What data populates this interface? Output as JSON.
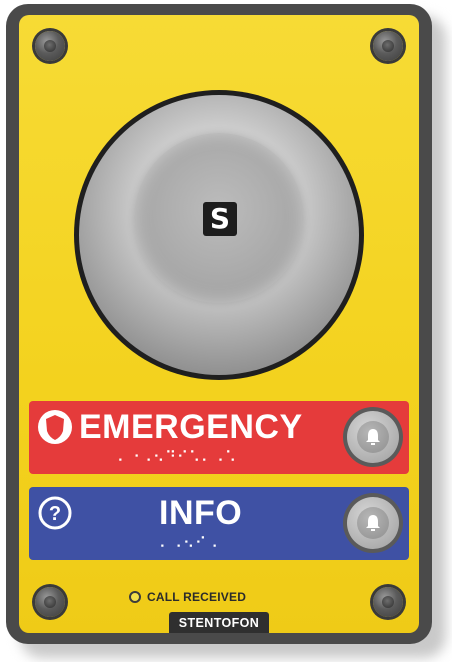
{
  "device": {
    "name": "STENTOFON",
    "logo_glyph": "S",
    "status_label": "CALL RECEIVED",
    "colors": {
      "faceplate": "#f3d21e",
      "frame": "#4a4a4a",
      "emergency": "#e53b3b",
      "info": "#3f51a4"
    }
  },
  "buttons": {
    "emergency": {
      "label": "EMERGENCY",
      "icon": "shield-icon",
      "braille": "⠄⠐⠠⠢⠙⠊⠡⠄⠠⠡",
      "button_icon": "bell-icon"
    },
    "info": {
      "label": "INFO",
      "icon": "question-icon",
      "braille": "⠄⠠⠢⠊⠠",
      "button_icon": "bell-icon"
    }
  }
}
